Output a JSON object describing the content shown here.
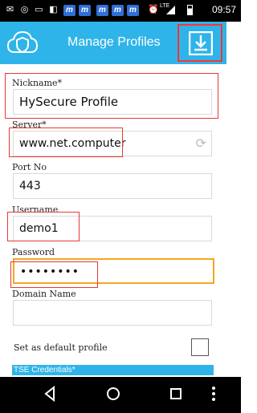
{
  "status_bar": {
    "time": "09:57",
    "network": "LTE",
    "icons": [
      "whatsapp-icon",
      "message-icon",
      "notification-icon",
      "m-app-icon",
      "m-app-icon",
      "m-app-icon",
      "m-app-icon",
      "m-app-icon",
      "alarm-icon",
      "signal-icon",
      "battery-icon"
    ],
    "m_icon_label": "m"
  },
  "header": {
    "title": "Manage Profiles",
    "left_icon": "cloud-shield-icon",
    "right_icon": "download-icon",
    "color": "#2fb4e9"
  },
  "form": {
    "nickname": {
      "label": "Nickname*",
      "value": "HySecure Profile"
    },
    "server": {
      "label": "Server*",
      "value": "www.net.computer"
    },
    "port": {
      "label": "Port No",
      "value": "443"
    },
    "username": {
      "label": "Username",
      "value": "demo1"
    },
    "password": {
      "label": "Password",
      "value": "••••••••"
    },
    "domain": {
      "label": "Domain Name",
      "value": ""
    },
    "default_profile": {
      "label": "Set as default profile",
      "checked": false
    },
    "tse_credentials": {
      "label": "TSE Credentials*"
    }
  },
  "colors": {
    "accent": "#2fb4e9",
    "highlight_red": "#e53935",
    "focus_orange": "#f5a623"
  },
  "navbar": {
    "icons": [
      "back-icon",
      "home-icon",
      "recents-icon",
      "more-icon"
    ]
  }
}
